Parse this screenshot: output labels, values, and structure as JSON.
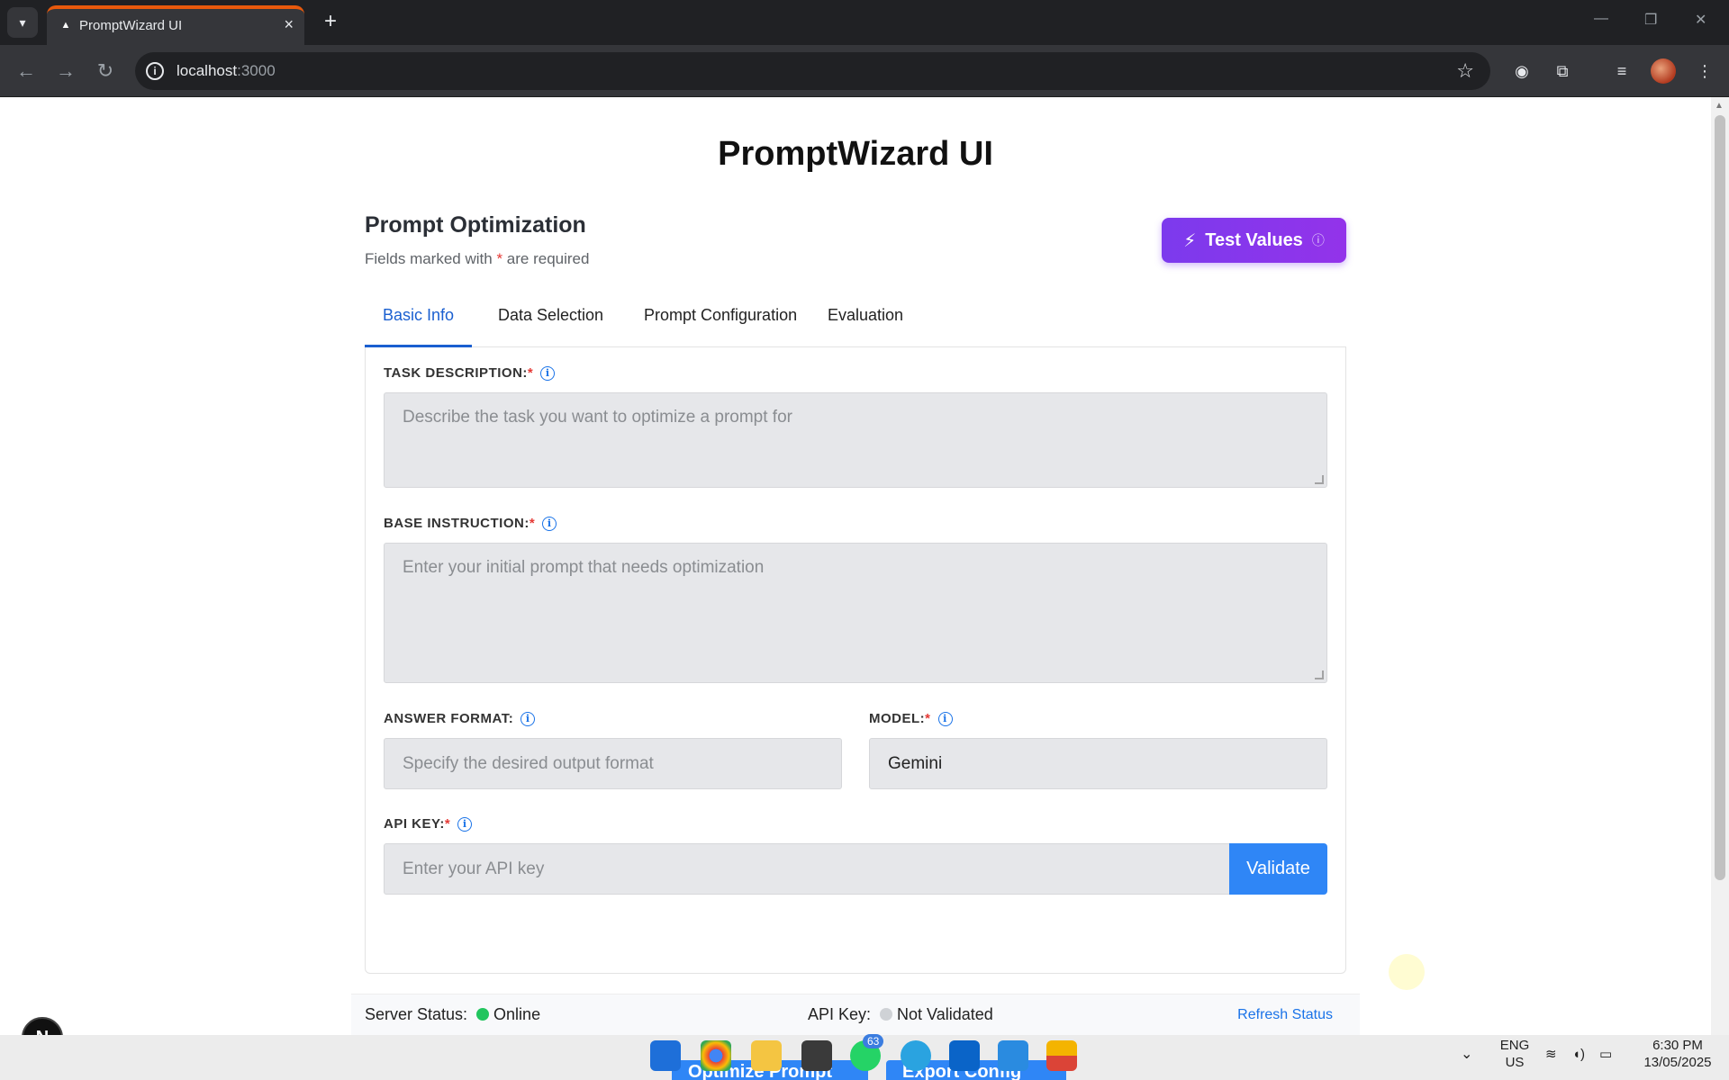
{
  "browser": {
    "tab_title": "PromptWizard UI",
    "url_host": "localhost",
    "url_port": ":3000"
  },
  "app": {
    "title": "PromptWizard UI"
  },
  "section": {
    "title": "Prompt Optimization",
    "subtitle_before": "Fields marked with ",
    "subtitle_req": "*",
    "subtitle_after": " are required",
    "test_button": "Test Values"
  },
  "tabs": [
    {
      "label": "Basic Info",
      "active": true
    },
    {
      "label": "Data Selection",
      "active": false
    },
    {
      "label": "Prompt Configuration",
      "active": false
    },
    {
      "label": "Evaluation",
      "active": false
    }
  ],
  "form": {
    "task_description": {
      "label": "TASK DESCRIPTION:",
      "required": "*",
      "placeholder": "Describe the task you want to optimize a prompt for"
    },
    "base_instruction": {
      "label": "BASE INSTRUCTION:",
      "required": "*",
      "placeholder": "Enter your initial prompt that needs optimization"
    },
    "answer_format": {
      "label": "ANSWER FORMAT:",
      "placeholder": "Specify the desired output format"
    },
    "model": {
      "label": "MODEL:",
      "required": "*",
      "value": "Gemini"
    },
    "api_key": {
      "label": "API KEY:",
      "required": "*",
      "placeholder": "Enter your API key",
      "button": "Validate"
    }
  },
  "status": {
    "server_label": "Server Status:",
    "server_value": "Online",
    "server_color": "#22c55e",
    "api_label": "API Key:",
    "api_value": "Not Validated",
    "api_color": "#cfd2d6",
    "refresh": "Refresh Status"
  },
  "overlay": {
    "next_badge": "N",
    "optimize_button": "Optimize Prompt",
    "export_button": "Export Config"
  },
  "taskbar": {
    "whatsapp_badge": "63",
    "lang_top": "ENG",
    "lang_bottom": "US",
    "time": "6:30 PM",
    "date": "13/05/2025"
  },
  "colors": {
    "accent": "#1a5fd0",
    "primary_button": "#2f86f6",
    "test_button": "#7c3aed",
    "required": "#e53935"
  }
}
